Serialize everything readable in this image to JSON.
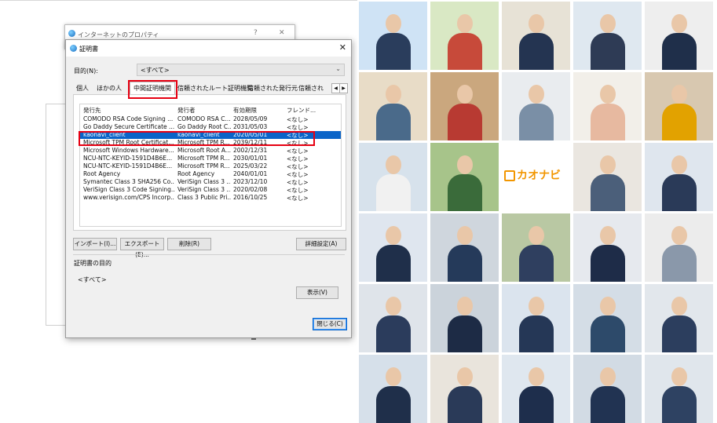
{
  "background_window": {
    "title": "インターネットのプロパティ",
    "help": "?",
    "close": "✕"
  },
  "dialog": {
    "title": "証明書",
    "close": "✕",
    "purpose_label": "目的(N):",
    "purpose_value": "<すべて>",
    "tabs": [
      "個人",
      "ほかの人",
      "中間証明機関",
      "信頼されたルート証明機関",
      "信頼された発行元",
      "信頼され"
    ],
    "active_tab": "中間証明機関",
    "columns": [
      "発行先",
      "発行者",
      "有効期限",
      "フレンド..."
    ],
    "rows": [
      {
        "issued_to": "COMODO RSA Code Signing ...",
        "issuer": "COMODO RSA C...",
        "expires": "2028/05/09",
        "friendly": "<なし>"
      },
      {
        "issued_to": "Go Daddy Secure Certificate ...",
        "issuer": "Go Daddy Root C...",
        "expires": "2031/05/03",
        "friendly": "<なし>"
      },
      {
        "issued_to": "kaonavi_client",
        "issuer": "kaonavi_client",
        "expires": "2020/05/01",
        "friendly": "<なし>"
      },
      {
        "issued_to": "Microsoft TPM Root Certificat...",
        "issuer": "Microsoft TPM R...",
        "expires": "2039/12/11",
        "friendly": "<なし>"
      },
      {
        "issued_to": "Microsoft Windows Hardware...",
        "issuer": "Microsoft Root A...",
        "expires": "2002/12/31",
        "friendly": "<なし>"
      },
      {
        "issued_to": "NCU-NTC-KEYID-1591D4B6E...",
        "issuer": "Microsoft TPM R...",
        "expires": "2030/01/01",
        "friendly": "<なし>"
      },
      {
        "issued_to": "NCU-NTC-KEYID-1591D4B6E...",
        "issuer": "Microsoft TPM R...",
        "expires": "2025/03/22",
        "friendly": "<なし>"
      },
      {
        "issued_to": "Root Agency",
        "issuer": "Root Agency",
        "expires": "2040/01/01",
        "friendly": "<なし>"
      },
      {
        "issued_to": "Symantec Class 3 SHA256 Co...",
        "issuer": "VeriSign Class 3 ...",
        "expires": "2023/12/10",
        "friendly": "<なし>"
      },
      {
        "issued_to": "VeriSign Class 3 Code Signing...",
        "issuer": "VeriSign Class 3 ...",
        "expires": "2020/02/08",
        "friendly": "<なし>"
      },
      {
        "issued_to": "www.verisign.com/CPS Incorp...",
        "issuer": "Class 3 Public Pri...",
        "expires": "2016/10/25",
        "friendly": "<なし>"
      }
    ],
    "selected_row": 2,
    "buttons": {
      "import": "インポート(I)...",
      "export": "エクスポート(E)...",
      "remove": "削除(R)",
      "advanced": "詳細設定(A)",
      "view": "表示(V)",
      "close": "閉じる(C)"
    },
    "purpose_group_label": "証明書の目的",
    "purpose_group_value": "<すべて>"
  },
  "brand": {
    "logo_text": "カオナビ",
    "logo_color": "#f29600"
  },
  "accent_colors": {
    "highlight": "#e60012",
    "selection": "#0a64c8"
  }
}
